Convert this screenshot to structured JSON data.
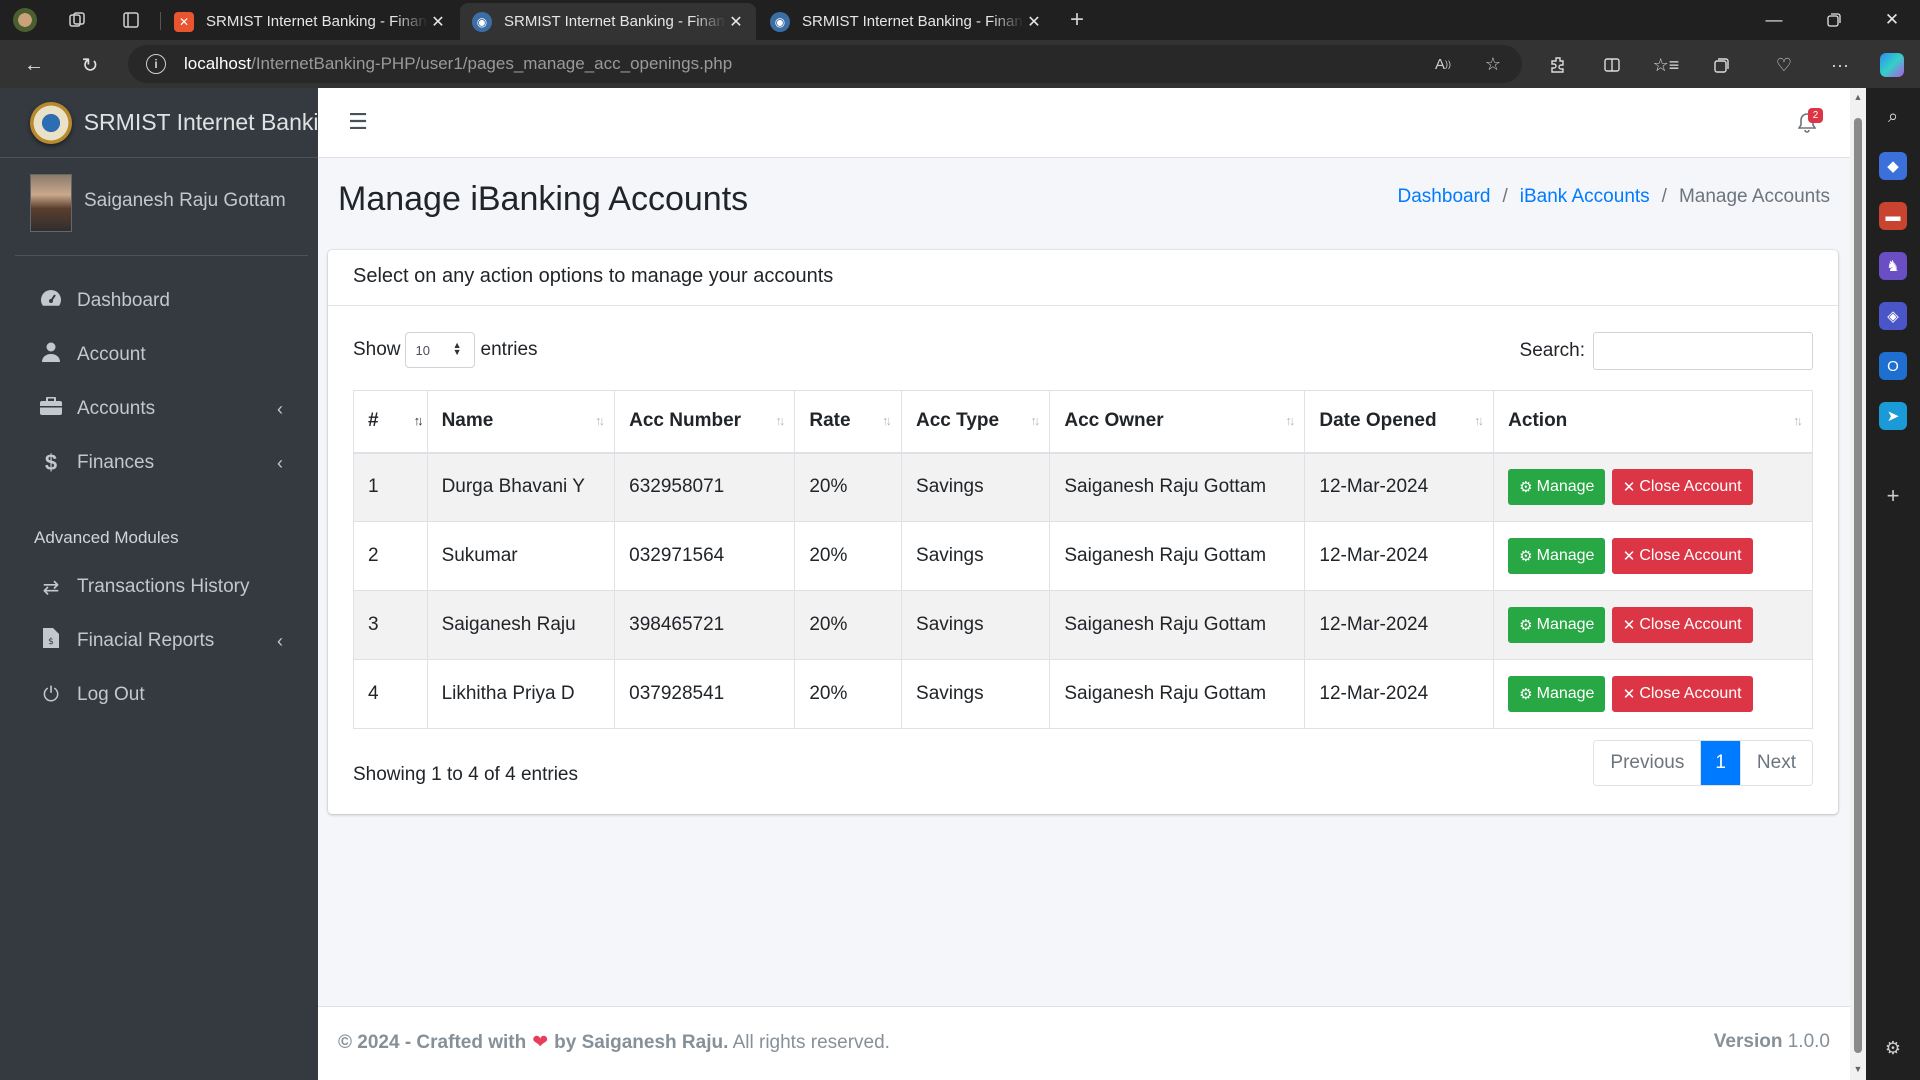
{
  "browser": {
    "tabs": [
      {
        "title": "SRMIST Internet Banking - Financial",
        "active": false,
        "favicon_color": "#e8552f"
      },
      {
        "title": "SRMIST Internet Banking - Financial",
        "active": true,
        "favicon_color": "#3a6ea5"
      },
      {
        "title": "SRMIST Internet Banking - Financial",
        "active": false,
        "favicon_color": "#3a6ea5"
      }
    ],
    "url_host": "localhost",
    "url_path": "/InternetBanking-PHP/user1/pages_manage_acc_openings.php"
  },
  "sidebar": {
    "brand": "SRMIST Internet Banking",
    "user_name": "Saiganesh Raju Gottam",
    "items": [
      {
        "label": "Dashboard",
        "icon": "dashboard-icon"
      },
      {
        "label": "Account",
        "icon": "user-icon"
      },
      {
        "label": "Accounts",
        "icon": "briefcase-icon",
        "caret": true
      },
      {
        "label": "Finances",
        "icon": "dollar-icon",
        "caret": true
      }
    ],
    "section_header": "Advanced Modules",
    "advanced_items": [
      {
        "label": "Transactions History",
        "icon": "exchange-icon"
      },
      {
        "label": "Finacial Reports",
        "icon": "report-icon",
        "caret": true
      },
      {
        "label": "Log Out",
        "icon": "power-icon"
      }
    ]
  },
  "topnav": {
    "notification_count": "2"
  },
  "page": {
    "title": "Manage iBanking Accounts",
    "breadcrumb": [
      "Dashboard",
      "iBank Accounts",
      "Manage Accounts"
    ]
  },
  "card": {
    "header": "Select on any action options to manage your accounts",
    "show_label": "Show",
    "entries_value": "10",
    "entries_label": "entries",
    "search_label": "Search:",
    "columns": [
      "#",
      "Name",
      "Acc Number",
      "Rate",
      "Acc Type",
      "Acc Owner",
      "Date Opened",
      "Action"
    ],
    "rows": [
      {
        "n": "1",
        "name": "Durga Bhavani Y",
        "acc": "632958071",
        "rate": "20%",
        "type": "Savings",
        "owner": "Saiganesh Raju Gottam",
        "date": "12-Mar-2024"
      },
      {
        "n": "2",
        "name": "Sukumar",
        "acc": "032971564",
        "rate": "20%",
        "type": "Savings",
        "owner": "Saiganesh Raju Gottam",
        "date": "12-Mar-2024"
      },
      {
        "n": "3",
        "name": "Saiganesh Raju",
        "acc": "398465721",
        "rate": "20%",
        "type": "Savings",
        "owner": "Saiganesh Raju Gottam",
        "date": "12-Mar-2024"
      },
      {
        "n": "4",
        "name": "Likhitha Priya D",
        "acc": "037928541",
        "rate": "20%",
        "type": "Savings",
        "owner": "Saiganesh Raju Gottam",
        "date": "12-Mar-2024"
      }
    ],
    "manage_label": "Manage",
    "close_label": "Close Account",
    "info": "Showing 1 to 4 of 4 entries",
    "pager": {
      "previous": "Previous",
      "page": "1",
      "next": "Next"
    }
  },
  "footer": {
    "left_a": "© 2024 - Crafted with",
    "left_b": "by Saiganesh Raju.",
    "left_c": "All rights reserved.",
    "version_label": "Version",
    "version": "1.0.0"
  },
  "colors": {
    "sidebar": "#343a40",
    "primary": "#007bff",
    "success": "#28a745",
    "danger": "#dc3545"
  }
}
